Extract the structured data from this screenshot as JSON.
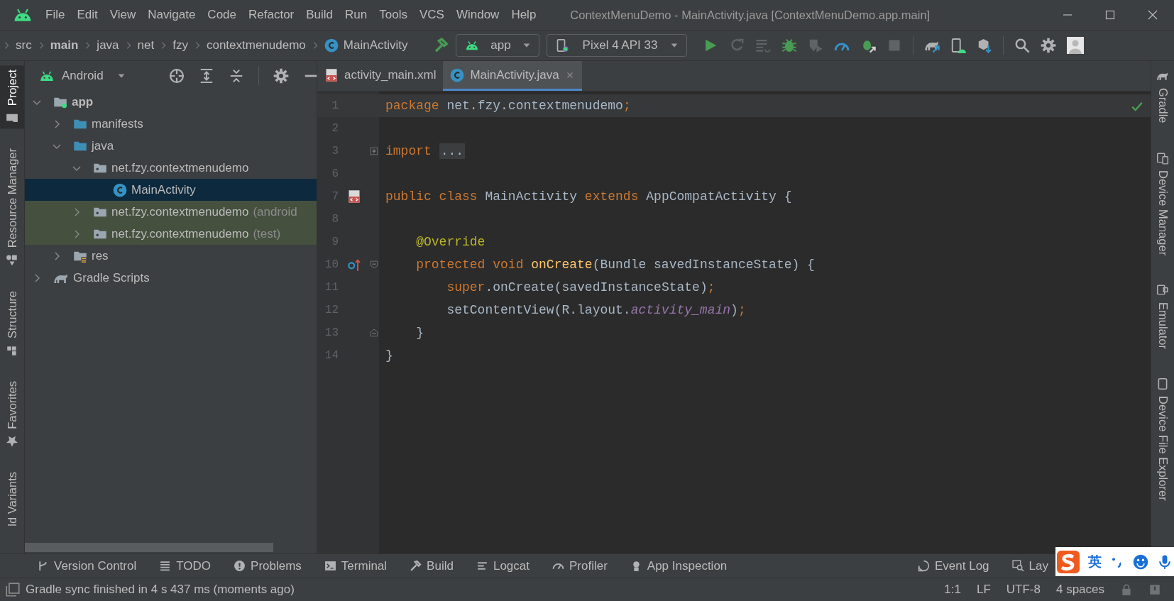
{
  "window": {
    "title": "ContextMenuDemo - MainActivity.java [ContextMenuDemo.app.main]"
  },
  "menu": [
    "File",
    "Edit",
    "View",
    "Navigate",
    "Code",
    "Refactor",
    "Build",
    "Run",
    "Tools",
    "VCS",
    "Window",
    "Help"
  ],
  "breadcrumb": [
    {
      "label": "src",
      "bold": false
    },
    {
      "label": "main",
      "bold": true
    },
    {
      "label": "java",
      "bold": false
    },
    {
      "label": "net",
      "bold": false
    },
    {
      "label": "fzy",
      "bold": false
    },
    {
      "label": "contextmenudemo",
      "bold": false
    },
    {
      "label": "MainActivity",
      "bold": false,
      "kind": "class"
    }
  ],
  "run_config": {
    "label": "app"
  },
  "device": {
    "label": "Pixel 4 API 33"
  },
  "left_stripe": [
    {
      "label": "Project",
      "kind": "project",
      "selected": true
    },
    {
      "label": "Resource Manager",
      "kind": "resources",
      "selected": false
    },
    {
      "label": "Structure",
      "kind": "structure",
      "selected": false
    },
    {
      "label": "Favorites",
      "kind": "favorites",
      "selected": false
    },
    {
      "label": "ld Variants",
      "kind": "variants",
      "selected": false
    }
  ],
  "project_panel": {
    "view": "Android",
    "tree": [
      {
        "label": "app",
        "kind": "module",
        "bold": true,
        "expanded": true,
        "selected": false,
        "children": [
          {
            "label": "manifests",
            "kind": "folder",
            "expanded": false,
            "selected": false
          },
          {
            "label": "java",
            "kind": "folder",
            "expanded": true,
            "selected": false,
            "children": [
              {
                "label": "net.fzy.contextmenudemo",
                "kind": "package",
                "expanded": true,
                "selected": false,
                "children": [
                  {
                    "label": "MainActivity",
                    "kind": "class",
                    "selected": true
                  }
                ]
              },
              {
                "label": "net.fzy.contextmenudemo",
                "suffix": "(android",
                "kind": "package",
                "expanded": false,
                "test": true,
                "selected": false
              },
              {
                "label": "net.fzy.contextmenudemo",
                "suffix": "(test)",
                "kind": "package",
                "expanded": false,
                "test": true,
                "selected": false
              }
            ]
          },
          {
            "label": "res",
            "kind": "res",
            "expanded": false,
            "selected": false
          }
        ]
      },
      {
        "label": "Gradle Scripts",
        "kind": "gradle",
        "expanded": false,
        "selected": false
      }
    ]
  },
  "editor": {
    "tabs": [
      {
        "label": "activity_main.xml",
        "kind": "xml",
        "selected": false
      },
      {
        "label": "MainActivity.java",
        "kind": "class",
        "selected": true
      }
    ],
    "lines": [
      {
        "number": "1",
        "current": true,
        "tokens": [
          {
            "kind": "kw",
            "text": "package"
          },
          {
            "kind": "plain",
            "text": " net.fzy.contextmenudemo"
          },
          {
            "kind": "kw",
            "text": ";"
          }
        ]
      },
      {
        "number": "2"
      },
      {
        "number": "3",
        "fold": {
          "kind": "expand"
        },
        "tokens": [
          {
            "kind": "kw",
            "text": "import "
          },
          {
            "kind": "folded",
            "text": "..."
          }
        ]
      },
      {
        "number": "6"
      },
      {
        "number": "7",
        "marker": {
          "kind": "layout"
        },
        "tokens": [
          {
            "kind": "kw",
            "text": "public class"
          },
          {
            "kind": "plain",
            "text": " MainActivity "
          },
          {
            "kind": "kw",
            "text": "extends"
          },
          {
            "kind": "plain",
            "text": " AppCompatActivity {"
          }
        ]
      },
      {
        "number": "8"
      },
      {
        "number": "9",
        "tokens": [
          {
            "kind": "anno",
            "text": "    @Override"
          }
        ]
      },
      {
        "number": "10",
        "marker": {
          "kind": "override"
        },
        "fold": {
          "kind": "start"
        },
        "tokens": [
          {
            "kind": "kw",
            "text": "    protected void "
          },
          {
            "kind": "method",
            "text": "onCreate"
          },
          {
            "kind": "plain",
            "text": "(Bundle savedInstanceState) {"
          }
        ]
      },
      {
        "number": "11",
        "tokens": [
          {
            "kind": "kw",
            "text": "        super"
          },
          {
            "kind": "plain",
            "text": ".onCreate(savedInstanceState)"
          },
          {
            "kind": "kw",
            "text": ";"
          }
        ]
      },
      {
        "number": "12",
        "tokens": [
          {
            "kind": "plain",
            "text": "        setContentView(R.layout."
          },
          {
            "kind": "field",
            "text": "activity_main"
          },
          {
            "kind": "plain",
            "text": ")"
          },
          {
            "kind": "kw",
            "text": ";"
          }
        ]
      },
      {
        "number": "13",
        "fold": {
          "kind": "end"
        },
        "tokens": [
          {
            "kind": "plain",
            "text": "    }"
          }
        ]
      },
      {
        "number": "14",
        "tokens": [
          {
            "kind": "plain",
            "text": "}"
          }
        ]
      }
    ]
  },
  "right_stripe": [
    {
      "label": "Gradle",
      "kind": "gradle"
    },
    {
      "label": "Device Manager",
      "kind": "device-manager"
    },
    {
      "label": "Emulator",
      "kind": "emulator"
    },
    {
      "label": "Device File Explorer",
      "kind": "file-explorer"
    }
  ],
  "bottom_tools": [
    {
      "label": "Version Control",
      "kind": "vcs"
    },
    {
      "label": "TODO",
      "kind": "todo"
    },
    {
      "label": "Problems",
      "kind": "problems"
    },
    {
      "label": "Terminal",
      "kind": "terminal"
    },
    {
      "label": "Build",
      "kind": "build"
    },
    {
      "label": "Logcat",
      "kind": "logcat"
    },
    {
      "label": "Profiler",
      "kind": "profiler"
    },
    {
      "label": "App Inspection",
      "kind": "inspection"
    }
  ],
  "bottom_tools_right": [
    {
      "label": "Event Log",
      "kind": "event-log"
    },
    {
      "label": "Lay",
      "kind": "layout-inspector"
    }
  ],
  "status_bar": {
    "message": "Gradle sync finished in 4 s 437 ms (moments ago)",
    "items": [
      "1:1",
      "LF",
      "UTF-8",
      "4 spaces"
    ]
  },
  "ime": {
    "mode": "英"
  }
}
